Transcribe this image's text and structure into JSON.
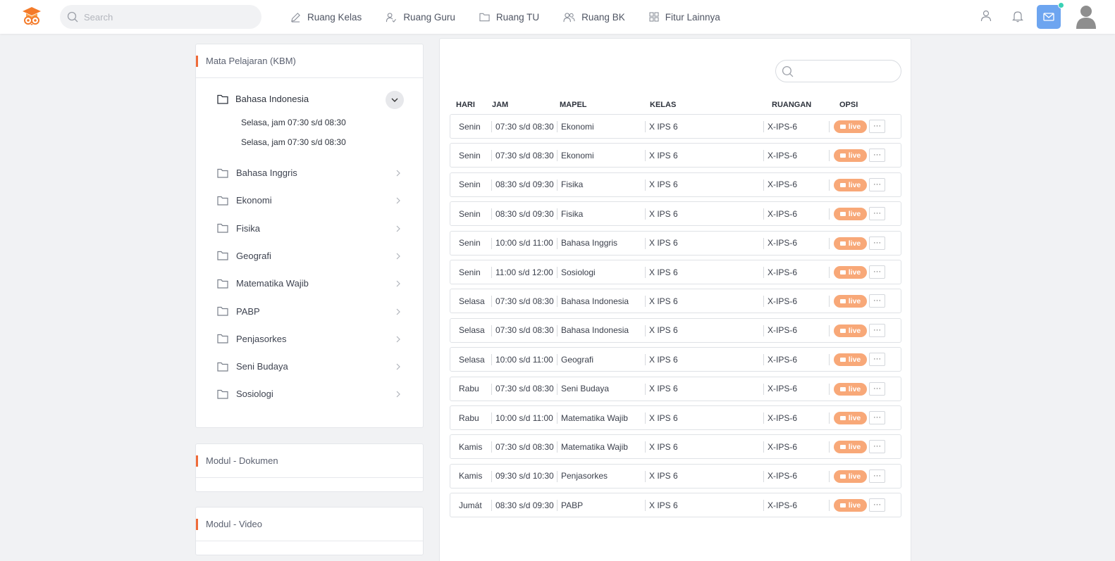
{
  "header": {
    "search_placeholder": "Search",
    "nav": [
      {
        "label": "Ruang Kelas",
        "icon": "pencil-icon"
      },
      {
        "label": "Ruang Guru",
        "icon": "user-check-icon"
      },
      {
        "label": "Ruang TU",
        "icon": "folder-icon"
      },
      {
        "label": "Ruang BK",
        "icon": "users-icon"
      },
      {
        "label": "Fitur Lainnya",
        "icon": "grid-icon"
      }
    ]
  },
  "sidebar": {
    "kbm_title": "Mata Pelajaran  (KBM)",
    "expanded_subject": "Bahasa Indonesia",
    "expanded_schedule": [
      "Selasa, jam  07:30 s/d 08:30",
      "Selasa, jam  07:30 s/d 08:30"
    ],
    "subjects": [
      "Bahasa Inggris",
      "Ekonomi",
      "Fisika",
      "Geografi",
      "Matematika Wajib",
      "PABP",
      "Penjasorkes",
      "Seni Budaya",
      "Sosiologi"
    ],
    "dokumen_title": "Modul - Dokumen",
    "video_title": "Modul - Video"
  },
  "table": {
    "headers": {
      "hari": "HARI",
      "jam": "JAM",
      "mapel": "MAPEL",
      "kelas": "KELAS",
      "ruangan": "RUANGAN",
      "opsi": "OPSI"
    },
    "live_label": "live",
    "more_label": "···",
    "rows": [
      {
        "hari": "Senin",
        "jam": "07:30 s/d 08:30",
        "mapel": "Ekonomi",
        "kelas": "X IPS 6",
        "ruangan": "X-IPS-6"
      },
      {
        "hari": "Senin",
        "jam": "07:30 s/d 08:30",
        "mapel": "Ekonomi",
        "kelas": "X IPS 6",
        "ruangan": "X-IPS-6"
      },
      {
        "hari": "Senin",
        "jam": "08:30 s/d 09:30",
        "mapel": "Fisika",
        "kelas": "X IPS 6",
        "ruangan": "X-IPS-6"
      },
      {
        "hari": "Senin",
        "jam": "08:30 s/d 09:30",
        "mapel": "Fisika",
        "kelas": "X IPS 6",
        "ruangan": "X-IPS-6"
      },
      {
        "hari": "Senin",
        "jam": "10:00 s/d 11:00",
        "mapel": "Bahasa Inggris",
        "kelas": "X IPS 6",
        "ruangan": "X-IPS-6"
      },
      {
        "hari": "Senin",
        "jam": "11:00 s/d 12:00",
        "mapel": "Sosiologi",
        "kelas": "X IPS 6",
        "ruangan": "X-IPS-6"
      },
      {
        "hari": "Selasa",
        "jam": "07:30 s/d 08:30",
        "mapel": "Bahasa Indonesia",
        "kelas": "X IPS 6",
        "ruangan": "X-IPS-6"
      },
      {
        "hari": "Selasa",
        "jam": "07:30 s/d 08:30",
        "mapel": "Bahasa Indonesia",
        "kelas": "X IPS 6",
        "ruangan": "X-IPS-6"
      },
      {
        "hari": "Selasa",
        "jam": "10:00 s/d 11:00",
        "mapel": "Geografi",
        "kelas": "X IPS 6",
        "ruangan": "X-IPS-6"
      },
      {
        "hari": "Rabu",
        "jam": "07:30 s/d 08:30",
        "mapel": "Seni Budaya",
        "kelas": "X IPS 6",
        "ruangan": "X-IPS-6"
      },
      {
        "hari": "Rabu",
        "jam": "10:00 s/d 11:00",
        "mapel": "Matematika Wajib",
        "kelas": "X IPS 6",
        "ruangan": "X-IPS-6"
      },
      {
        "hari": "Kamis",
        "jam": "07:30 s/d 08:30",
        "mapel": "Matematika Wajib",
        "kelas": "X IPS 6",
        "ruangan": "X-IPS-6"
      },
      {
        "hari": "Kamis",
        "jam": "09:30 s/d 10:30",
        "mapel": "Penjasorkes",
        "kelas": "X IPS 6",
        "ruangan": "X-IPS-6"
      },
      {
        "hari": "Jumát",
        "jam": "08:30 s/d 09:30",
        "mapel": "PABP",
        "kelas": "X IPS 6",
        "ruangan": "X-IPS-6"
      }
    ]
  },
  "colors": {
    "accent": "#ef6b3a",
    "live_badge": "#f8a878",
    "mail_button": "#6da5f0",
    "notification_dot": "#3ad1b5"
  }
}
